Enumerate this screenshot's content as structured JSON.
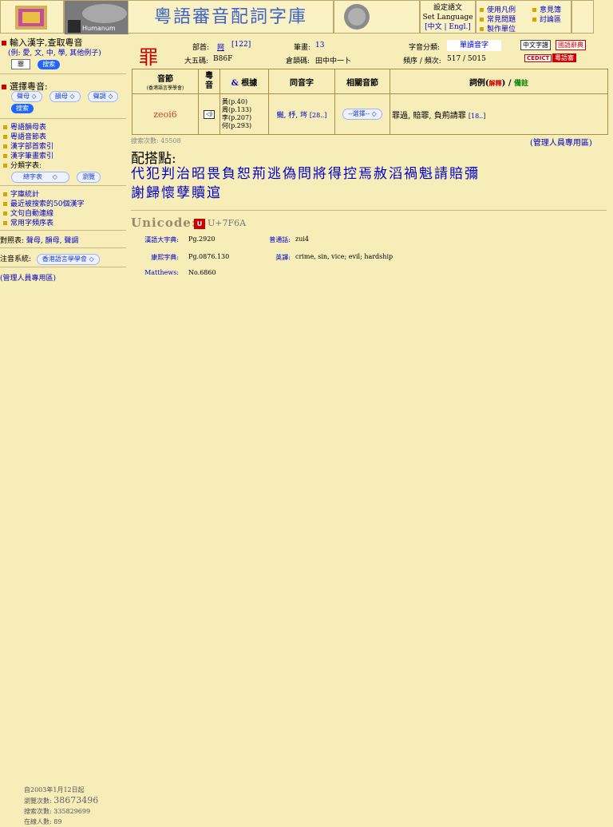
{
  "header": {
    "banner_title": "粵語審音配詞字庫",
    "logo2_text": "Humanum",
    "language": {
      "title": "設定語文",
      "subtitle": "Set Language",
      "options": "[中文 | Engl.]"
    },
    "menu": [
      "使用凡例",
      "常見問題",
      "製作單位",
      "意見簿",
      "討論區"
    ]
  },
  "left": {
    "input_heading": "輸入漢字,查取粵音",
    "example_text": "(例: 愛, 文, 中, 學, 其他例子)",
    "input_value": "罪",
    "search_label": "搜索",
    "select_heading": "選擇粵音:",
    "select_options": [
      "聲母",
      "韻母",
      "聲調"
    ],
    "links1": [
      "粵語韻母表",
      "粵語音節表",
      "漢字部首索引",
      "漢字筆畫索引",
      "分類字表:"
    ],
    "category_select": "總字表",
    "browse_label": "瀏覽",
    "links2": [
      "字庫統計",
      "最近被搜索的50個漢字",
      "文句自動連線",
      "常用字頻序表"
    ],
    "compare_label": "對照表:",
    "compare_links": "聲母, 韻母, 聲調",
    "system_label": "注音系統:",
    "system_value": "香港語言學學會",
    "admin_link": "(管理人員專用區)"
  },
  "entry": {
    "character": "罪",
    "radical_label": "部首:",
    "radical_value": "网",
    "radical_num": "[122]",
    "strokes_label": "筆畫:",
    "strokes_value": "13",
    "category_label": "字音分類:",
    "category_value": "單讀音字",
    "big5_label": "大五碼:",
    "big5_value": "B86F",
    "cangjie_label": "倉頡碼:",
    "cangjie_value": "田中中一卜",
    "freq_label": "頻序 / 頻次:",
    "freq_value": "517 / 5015",
    "badges": [
      "中文字譜",
      "國語辭典",
      "CEDICT",
      "粵語審"
    ]
  },
  "table": {
    "headers": {
      "syllable": "音節",
      "syllable_sub": "(香港語言學學會)",
      "sound": "粵音",
      "basis": "根據",
      "homophones": "同音字",
      "related": "相關音節",
      "examples_prefix": "詞例(",
      "examples_explain": "解釋",
      "examples_suffix": ") /",
      "notes": "備註"
    },
    "row": {
      "syllable": "zeoi6",
      "basis": [
        "黃(p.40)",
        "周(p.133)",
        "李(p.207)",
        "何(p.293)"
      ],
      "homophones": "鱡, 杼, 埁",
      "homophones_more": "[28..]",
      "related_select": "--選擇--",
      "examples": "罪過, 賠罪, 負荊請罪",
      "examples_more": "[18..]"
    }
  },
  "search_count": "搜索次數: 45508",
  "admin_link_right": "(管理人員專用區)",
  "collocation": {
    "title": "配搭點:",
    "line1": "代犯判治昭畏負恕荊逃偽問將得控焉赦滔禍魁請賠彌",
    "line2": "謝歸懷孽贖逭"
  },
  "unicode": {
    "label": "Unicode:",
    "value": "U+7F6A",
    "rows": [
      {
        "l1": "漢語大字典:",
        "v1": "Pg.2920",
        "l2": "普通話:",
        "v2": "zui4"
      },
      {
        "l1": "康熙字典:",
        "v1": "Pg.0876.130",
        "l2": "英譯:",
        "v2": "crime, sin, vice; evil; hardship"
      },
      {
        "l1": "Matthews:",
        "v1": "No.6860",
        "l2": "",
        "v2": ""
      }
    ]
  },
  "footer": {
    "since": "自2003年1月12日起",
    "views_label": "瀏覽次數",
    "views_value": "38673496",
    "search_label": "搜索次數",
    "search_value": "335829699",
    "online_label": "在線人數",
    "online_value": "89"
  },
  "colors": {
    "background": "#f7edb9",
    "link": "#0000cc",
    "red": "#cc0000",
    "pill": "#1e66ff"
  }
}
